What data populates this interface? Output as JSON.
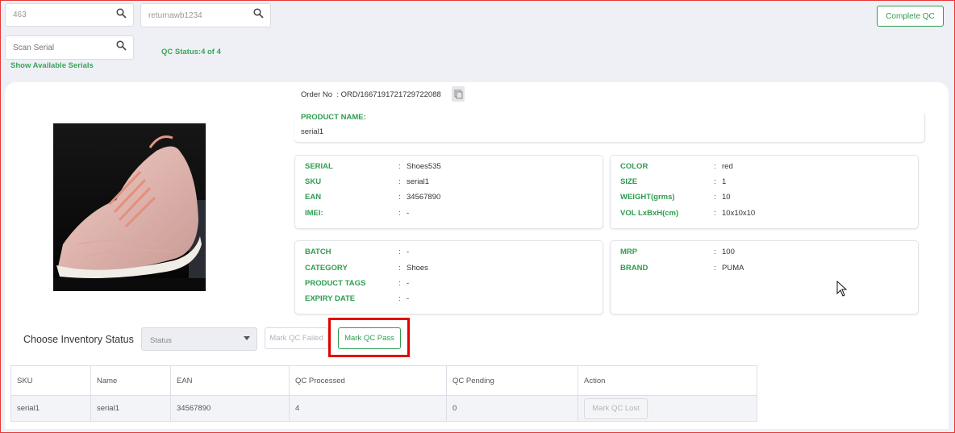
{
  "search": {
    "order_value": "463",
    "awb_value": "returnawb1234",
    "serial_placeholder": "Scan Serial",
    "show_serials_link": "Show Available Serials",
    "qc_status": "QC Status:4 of 4"
  },
  "header": {
    "complete_qc_label": "Complete QC"
  },
  "order": {
    "label": "Order No",
    "separator": ":",
    "number": "ORD/1667191721729722088",
    "product_name_label": "PRODUCT NAME:",
    "product_name": "serial1"
  },
  "details_left_top": [
    {
      "label": "SERIAL",
      "value": "Shoes535"
    },
    {
      "label": "SKU",
      "value": "serial1"
    },
    {
      "label": "EAN",
      "value": "34567890"
    },
    {
      "label": "IMEI:",
      "value": "-"
    }
  ],
  "details_right_top": [
    {
      "label": "COLOR",
      "value": "red"
    },
    {
      "label": "SIZE",
      "value": "1"
    },
    {
      "label": "WEIGHT(grms)",
      "value": "10"
    },
    {
      "label": "VOL LxBxH(cm)",
      "value": "10x10x10"
    }
  ],
  "details_left_bottom": [
    {
      "label": "BATCH",
      "value": "-"
    },
    {
      "label": "CATEGORY",
      "value": "Shoes"
    },
    {
      "label": "PRODUCT TAGS",
      "value": "-"
    },
    {
      "label": "EXPIRY DATE",
      "value": "-"
    }
  ],
  "details_right_bottom": [
    {
      "label": "MRP",
      "value": "100"
    },
    {
      "label": "BRAND",
      "value": "PUMA"
    }
  ],
  "inventory": {
    "label": "Choose Inventory Status",
    "status_placeholder": "Status",
    "mark_failed_label": "Mark QC Failed",
    "mark_pass_label": "Mark QC Pass"
  },
  "table": {
    "headers": [
      "SKU",
      "Name",
      "EAN",
      "QC Processed",
      "QC Pending",
      "Action"
    ],
    "rows": [
      {
        "sku": "serial1",
        "name": "serial1",
        "ean": "34567890",
        "qc_processed": "4",
        "qc_pending": "0",
        "action": "Mark QC Lost"
      }
    ]
  },
  "colors": {
    "accent": "#2e9d4f",
    "highlight": "#e20000",
    "background": "#eef0f5"
  },
  "icons": {
    "search": "search-icon",
    "copy": "copy-icon",
    "dropdown": "caret-down-icon",
    "cursor": "mouse-pointer-icon"
  }
}
